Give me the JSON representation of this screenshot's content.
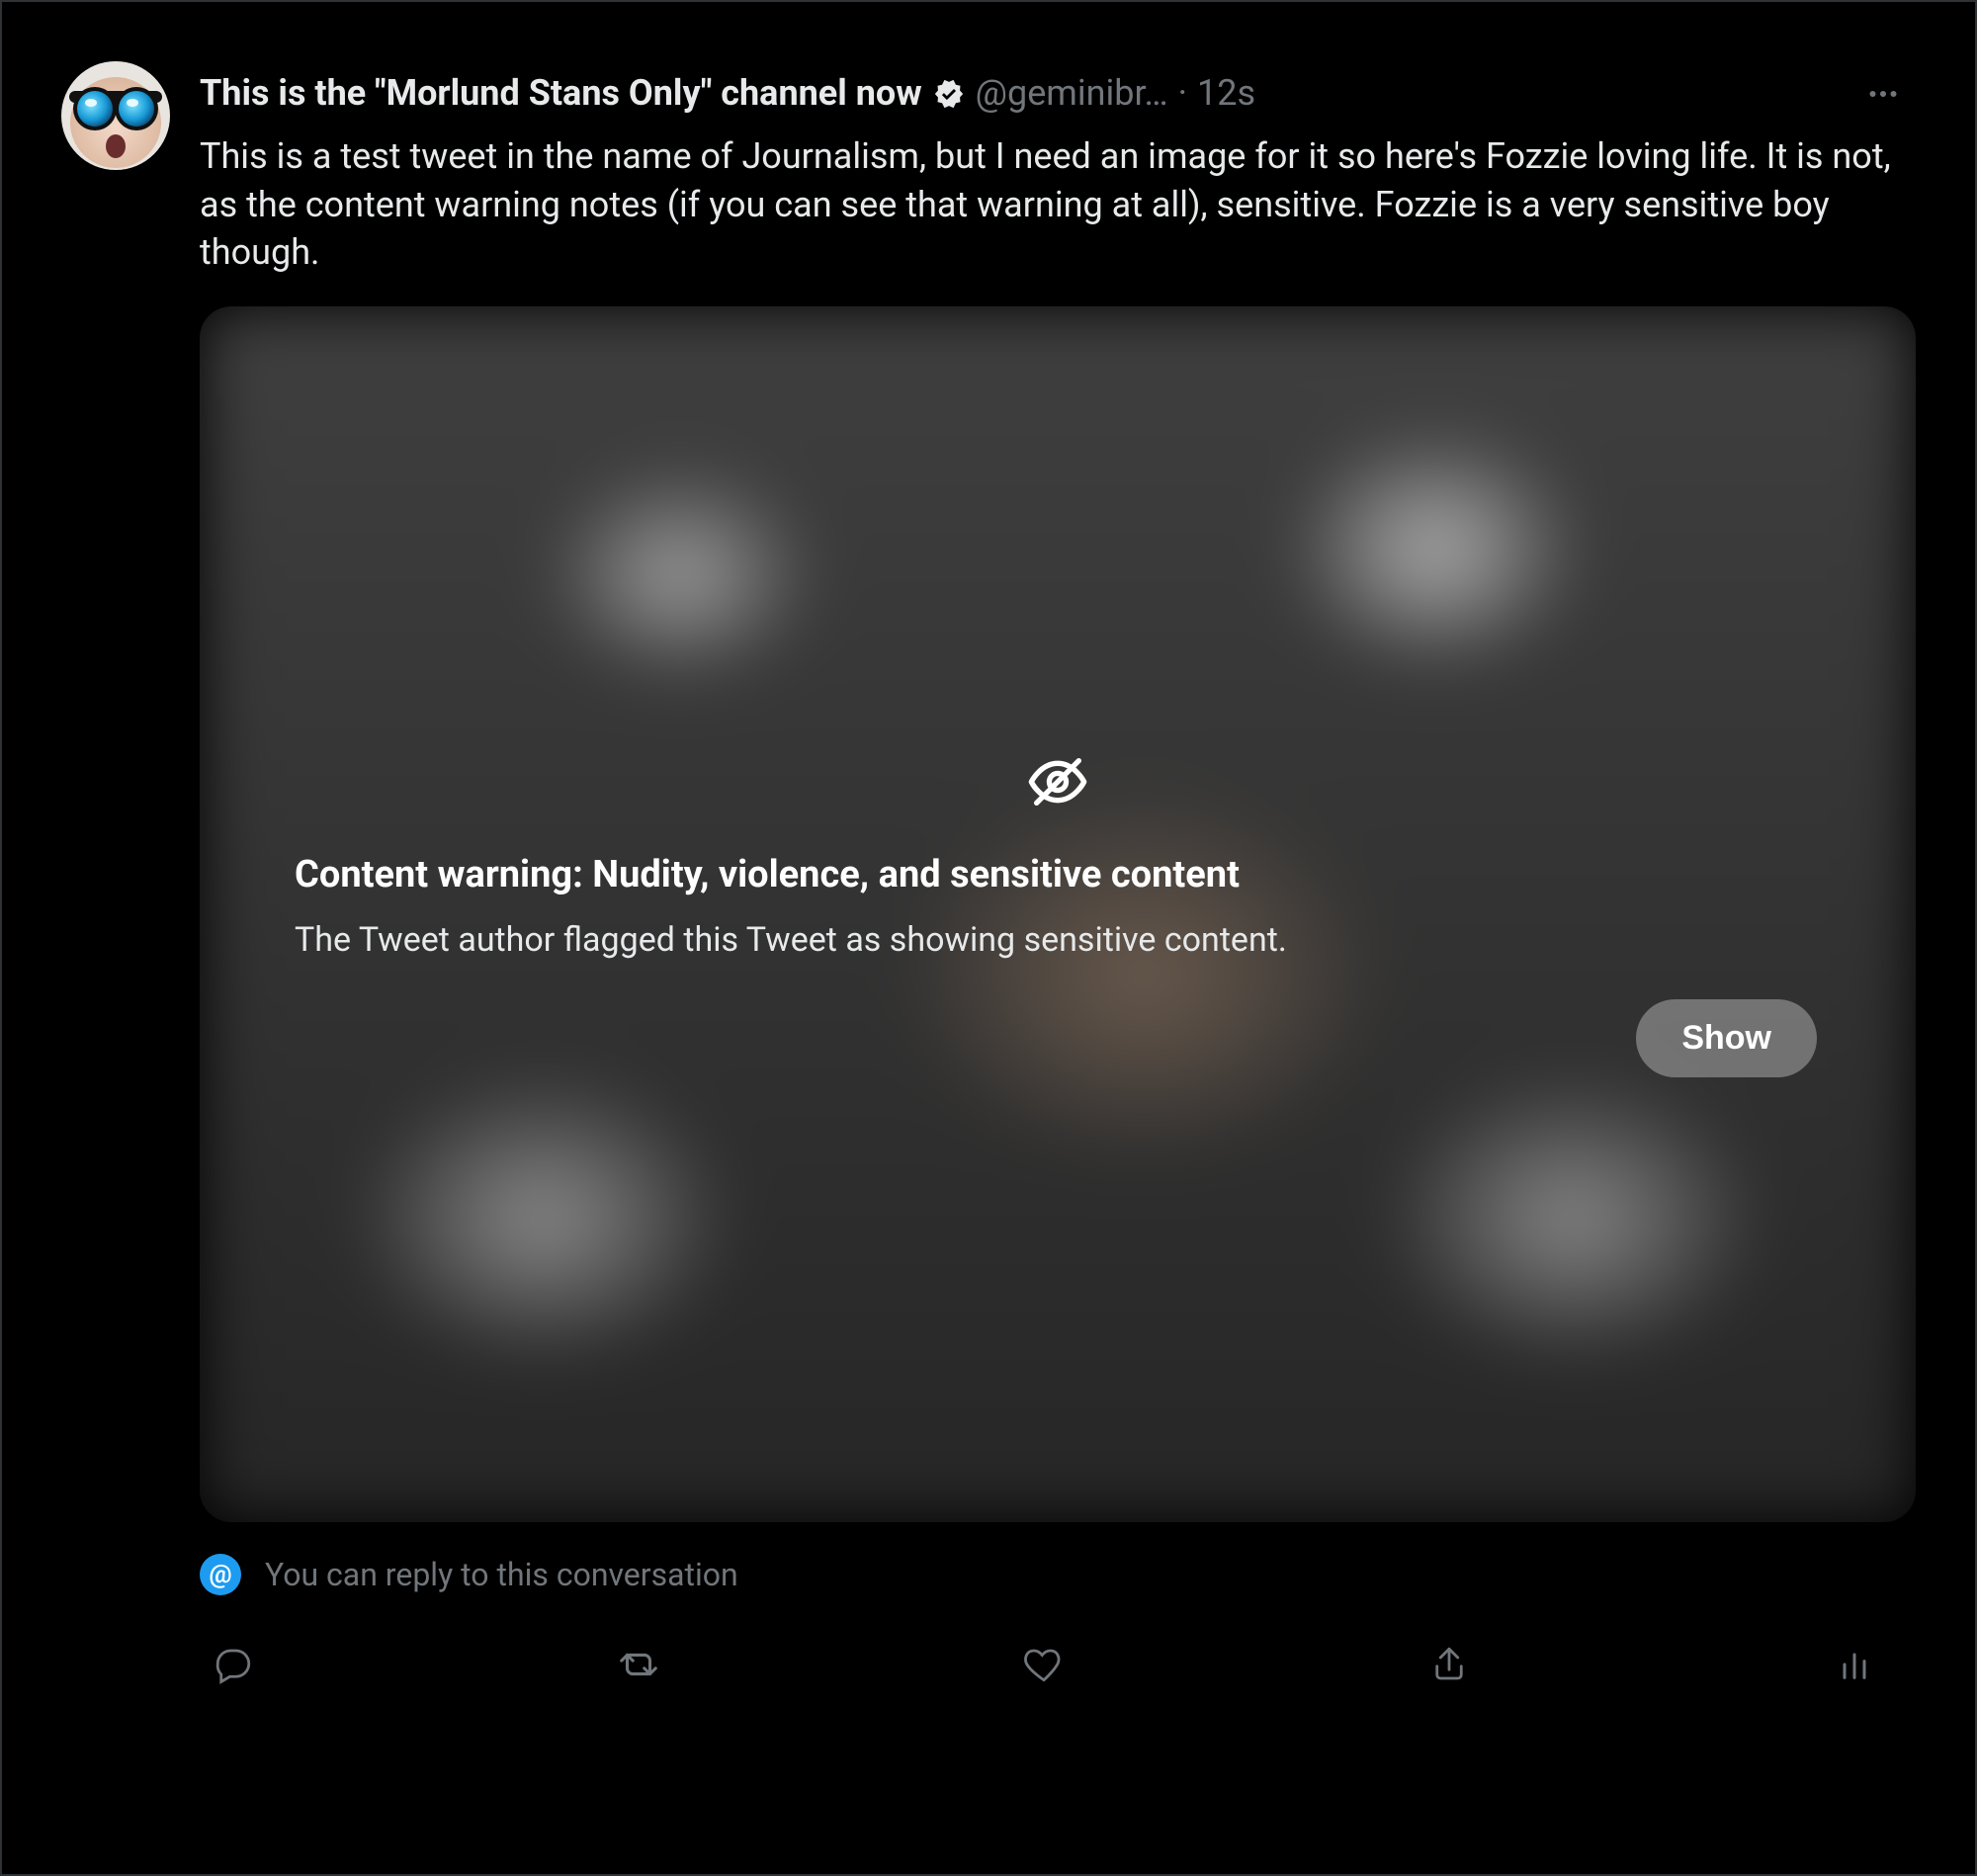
{
  "tweet": {
    "display_name": "This is the \"Morlund Stans Only\" channel now",
    "handle": "@geminibr…",
    "separator": "·",
    "timestamp": "12s",
    "body": "This is a test tweet in the name of Journalism, but I need an image for it so here's Fozzie loving life. It is not, as the content warning notes (if you can see that warning at all), sensitive. Fozzie is a very sensitive boy though.",
    "content_warning": {
      "title": "Content warning: Nudity, violence, and sensitive content",
      "subtitle": "The Tweet author flagged this Tweet as showing sensitive content.",
      "show_label": "Show"
    },
    "reply_hint": {
      "badge": "@",
      "text": "You can reply to this conversation"
    }
  }
}
